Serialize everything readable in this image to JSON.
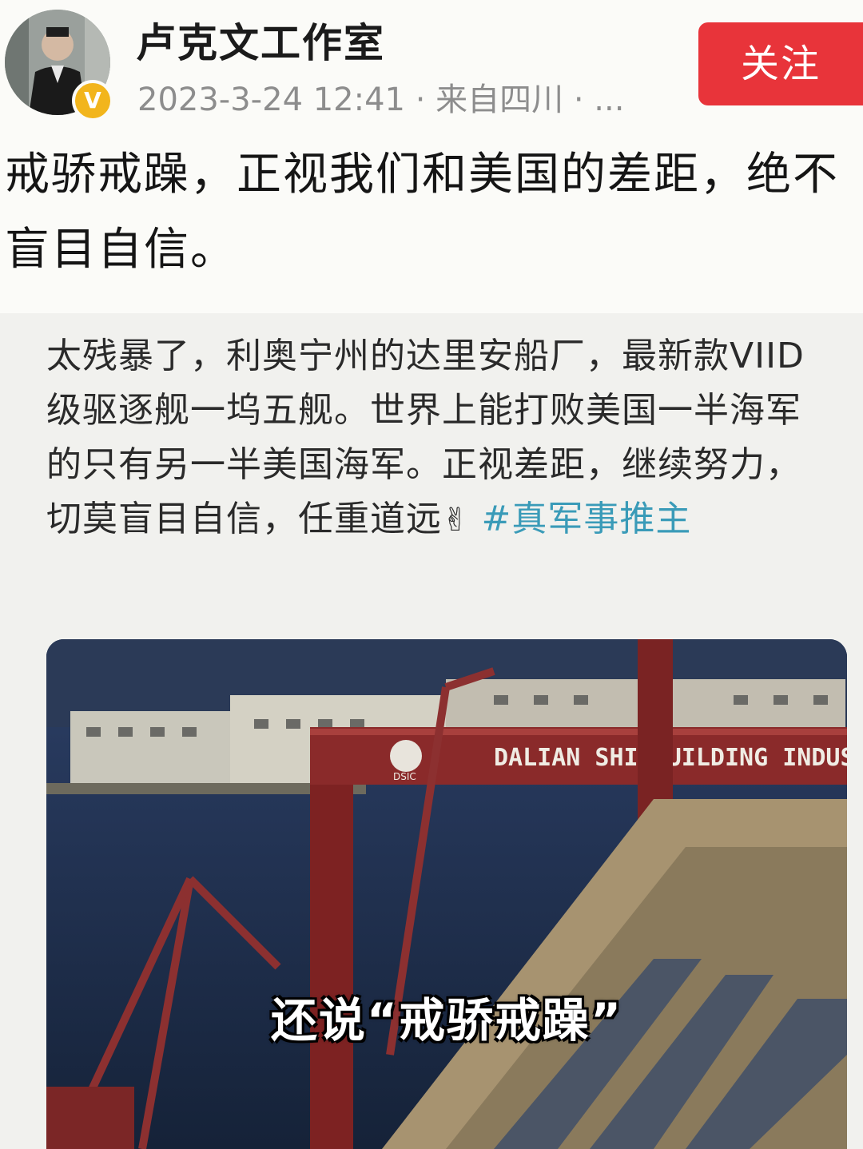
{
  "header": {
    "username": "卢克文工作室",
    "meta": "2023-3-24 12:41 · 来自四川 · ...",
    "follow_label": "关注",
    "avatar_icon": "person-avatar",
    "verified_icon": "verified-v-badge",
    "verified_mark": "V"
  },
  "post": {
    "text": "戒骄戒躁，正视我们和美国的差距，绝不盲目自信。"
  },
  "repost": {
    "text": "太残暴了，利奥宁州的达里安船厂，最新款VIID级驱逐舰一坞五舰。世界上能打败美国一半海军的只有另一半美国海军。正视差距，继续努力，切莫盲目自信，任重道远",
    "emoji": "✌",
    "hashtag": "#真军事推主"
  },
  "image": {
    "sign_text": "DALIAN SHIPBUILDING INDUSTRY",
    "logo_text": "DSIC",
    "subtitle": "还说“戒骄戒躁”"
  },
  "colors": {
    "follow_bg": "#e8343a",
    "hashtag": "#3a9bb8",
    "meta": "#8d8d8d",
    "badge": "#f2b51c"
  }
}
